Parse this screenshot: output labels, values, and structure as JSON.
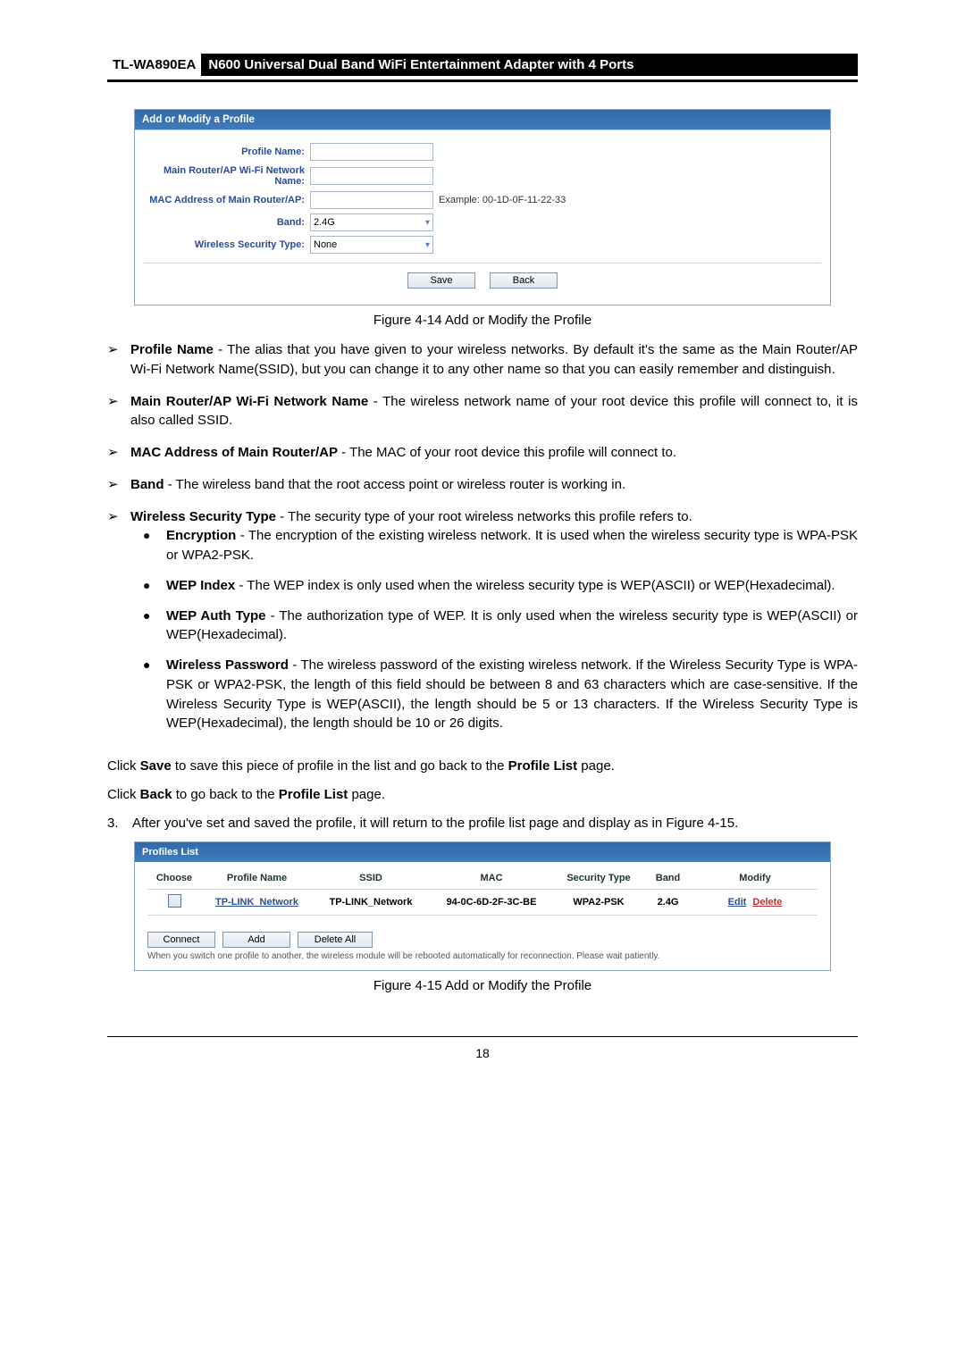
{
  "header": {
    "model": "TL-WA890EA",
    "title": "N600 Universal Dual Band WiFi Entertainment Adapter with 4 Ports"
  },
  "fig14": {
    "panel_title": "Add or Modify a Profile",
    "labels": {
      "profile_name": "Profile Name:",
      "network_name": "Main Router/AP Wi-Fi Network Name:",
      "mac": "MAC Address of Main Router/AP:",
      "band": "Band:",
      "security": "Wireless Security Type:"
    },
    "values": {
      "band": "2.4G",
      "security": "None",
      "mac_hint": "Example: 00-1D-0F-11-22-33"
    },
    "buttons": {
      "save": "Save",
      "back": "Back"
    },
    "caption": "Figure 4-14 Add or Modify the Profile"
  },
  "bullets": {
    "b1": {
      "label": "Profile Name",
      "text": " - The alias that you have given to your wireless networks. By default it's the same as the Main Router/AP Wi-Fi Network Name(SSID), but you can change it to any other name so that you can easily remember and distinguish."
    },
    "b2": {
      "label": "Main Router/AP Wi-Fi Network Name",
      "text": " - The wireless network name of your root device this profile will connect to, it is also called SSID."
    },
    "b3": {
      "label": "MAC Address of Main Router/AP",
      "text": " - The MAC of your root device this profile will connect to."
    },
    "b4": {
      "label": "Band",
      "text": " - The wireless band that the root access point or wireless router is working in."
    },
    "b5": {
      "label": "Wireless Security Type",
      "text": " - The security type of your root wireless networks this profile refers to."
    },
    "s1": {
      "label": "Encryption",
      "text": " - The encryption of the existing wireless network. It is used when the wireless security type is WPA-PSK or WPA2-PSK."
    },
    "s2": {
      "label": "WEP Index",
      "text": " - The WEP index is only used when the wireless security type is WEP(ASCII) or WEP(Hexadecimal)."
    },
    "s3": {
      "label": "WEP Auth Type",
      "text": " - The authorization type of WEP. It is only used when the wireless security type is WEP(ASCII) or WEP(Hexadecimal)."
    },
    "s4": {
      "label": "Wireless Password",
      "text": " - The wireless password of the existing wireless network. If the Wireless Security Type is WPA-PSK or WPA2-PSK, the length of this field should be between 8 and 63 characters which are case-sensitive. If the Wireless Security Type is WEP(ASCII), the length should be 5 or 13 characters. If the Wireless Security Type is WEP(Hexadecimal), the length should be 10 or 26 digits."
    }
  },
  "paras": {
    "p1_a": "Click ",
    "p1_b": "Save",
    "p1_c": " to save this piece of profile in the list and go back to the ",
    "p1_d": "Profile List",
    "p1_e": " page.",
    "p2_a": "Click ",
    "p2_b": "Back",
    "p2_c": " to go back to the ",
    "p2_d": "Profile List",
    "p2_e": " page.",
    "step3_num": "3.",
    "step3": "After you've set and saved the profile, it will return to the profile list page and display as in Figure 4-15."
  },
  "fig15": {
    "panel_title": "Profiles List",
    "headers": {
      "choose": "Choose",
      "pname": "Profile Name",
      "ssid": "SSID",
      "mac": "MAC",
      "sec": "Security Type",
      "band": "Band",
      "mod": "Modify"
    },
    "row": {
      "pname": "TP-LINK_Network",
      "ssid": "TP-LINK_Network",
      "mac": "94-0C-6D-2F-3C-BE",
      "sec": "WPA2-PSK",
      "band": "2.4G",
      "edit": "Edit",
      "del": "Delete"
    },
    "buttons": {
      "connect": "Connect",
      "add": "Add",
      "deleteall": "Delete All"
    },
    "note": "When you switch one profile to another, the wireless module will be rebooted automatically for reconnection. Please wait patiently.",
    "caption": "Figure 4-15 Add or Modify the Profile"
  },
  "page_number": "18"
}
